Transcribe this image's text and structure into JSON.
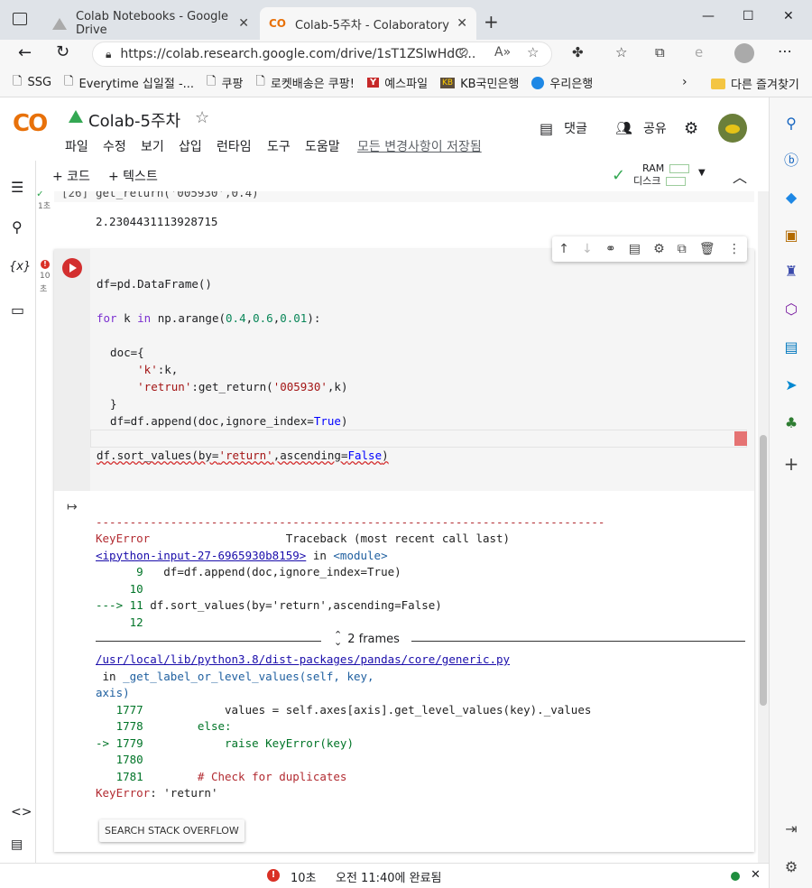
{
  "browser": {
    "tabs": [
      {
        "label": "Colab Notebooks - Google Drive",
        "active": false
      },
      {
        "label": "Colab-5주차 - Colaboratory",
        "active": true
      }
    ],
    "new_tab": "+",
    "url": "https://colab.research.google.com/drive/1sT1ZSlwHdC...",
    "window_controls": {
      "minimize": "—",
      "maximize": "☐",
      "close": "✕"
    },
    "bookmarks": [
      {
        "label": "SSG",
        "icon": "page-icon"
      },
      {
        "label": "Everytime 십일절 -...",
        "icon": "page-icon"
      },
      {
        "label": "쿠팡",
        "icon": "page-icon"
      },
      {
        "label": "로켓배송은 쿠팡!",
        "icon": "page-icon"
      },
      {
        "label": "예스파일",
        "icon": "yesfile-icon"
      },
      {
        "label": "KB국민은행",
        "icon": "kb-icon"
      },
      {
        "label": "우리은행",
        "icon": "woori-icon"
      }
    ],
    "other_favorites": "다른 즐겨찾기"
  },
  "colab": {
    "logo": "CO",
    "title": "Colab-5주차",
    "menu": [
      "파일",
      "수정",
      "보기",
      "삽입",
      "런타임",
      "도구",
      "도움말"
    ],
    "saved_status": "모든 변경사항이 저장됨",
    "comment": "댓글",
    "share": "공유",
    "add_code": "+ 코드",
    "add_text": "+ 텍스트",
    "ram": "RAM",
    "disk": "디스크"
  },
  "prev_cell": {
    "exec_count": "[26]",
    "code": "get_return('005930',0.4)",
    "time": "1초",
    "output": "2.2304431113928715"
  },
  "cell": {
    "time_a": "10",
    "time_b": "초",
    "code": {
      "l1": "df=pd.DataFrame()",
      "l2_kw1": "for",
      "l2_a": " k ",
      "l2_kw2": "in",
      "l2_b": " np.arange(",
      "l2_n1": "0.4",
      "l2_c1": ",",
      "l2_n2": "0.6",
      "l2_c2": ",",
      "l2_n3": "0.01",
      "l2_e": "):",
      "l3": "  doc={",
      "l4_s": "'k'",
      "l4_e": ":k,",
      "l5_s1": "'retrun'",
      "l5_m": ":get_return(",
      "l5_s2": "'005930'",
      "l5_e": ",k)",
      "l6": "  }",
      "l7_a": "  df=df.append(doc,ignore_index=",
      "l7_t": "True",
      "l7_e": ")",
      "l8_a": "df.sort_values(by=",
      "l8_s": "'return'",
      "l8_b": ",ascending=",
      "l8_f": "False",
      "l8_e": ")"
    }
  },
  "output": {
    "dashes": "---------------------------------------------------------------------------",
    "err_name": "KeyError",
    "traceback": "Traceback (most recent call last)",
    "input_link": "<ipython-input-27-6965930b8159>",
    "in_module_in": " in ",
    "in_module": "<module>",
    "tb_lines": [
      {
        "num": "      9",
        "code": "   df=df.append(doc,ignore_index=True)"
      },
      {
        "num": "     10",
        "code": ""
      },
      {
        "num": "---> 11",
        "code": " df.sort_values(by='return',ascending=False)"
      },
      {
        "num": "     12",
        "code": ""
      }
    ],
    "frames": "2 frames",
    "generic_link": "/usr/local/lib/python3.8/dist-packages/pandas/core/generic.py",
    "generic_in": " in ",
    "generic_fn": "_get_label_or_level_values(self, key,",
    "generic_fn2": "axis)",
    "src_lines": [
      {
        "num": "   1777",
        "code": "            values = self.axes[axis].get_level_values(key)._values"
      },
      {
        "num": "   1778",
        "code": "        else:"
      },
      {
        "num": "-> 1779",
        "code": "            raise KeyError(key)"
      },
      {
        "num": "   1780",
        "code": ""
      },
      {
        "num": "   1781",
        "code": "        # Check for duplicates"
      }
    ],
    "final_error": "KeyError",
    "final_msg": ": 'return'",
    "so_button": "SEARCH STACK OVERFLOW"
  },
  "statusbar": {
    "time": "10초",
    "message": "오전 11:40에 완료됨",
    "close": "✕"
  }
}
